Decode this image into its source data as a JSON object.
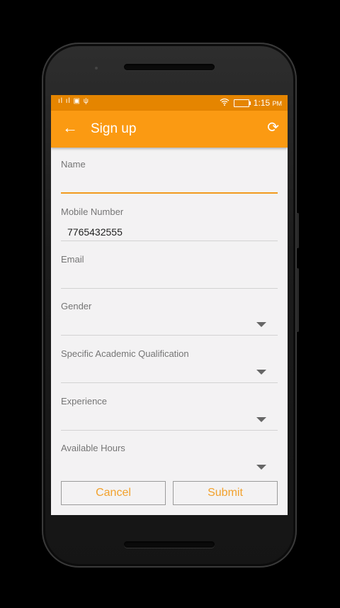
{
  "status_bar": {
    "left_icons": "ıl ıl ▣ ψ",
    "wifi_icon": "wifi-icon",
    "time": "1:15",
    "ampm": "PM"
  },
  "toolbar": {
    "back_icon": "←",
    "title": "Sign up",
    "refresh_icon": "⟳",
    "color": "#fb9a12"
  },
  "form": {
    "name_label": "Name",
    "name_value": "",
    "mobile_label": "Mobile Number",
    "mobile_value": "7765432555",
    "email_label": "Email",
    "email_value": "",
    "gender_label": "Gender",
    "qualification_label": "Specific Academic Qualification",
    "experience_label": "Experience",
    "hours_label": "Available Hours"
  },
  "buttons": {
    "cancel": "Cancel",
    "submit": "Submit"
  },
  "colors": {
    "accent": "#fb9a12",
    "status": "#e58500",
    "button_text": "#f2a12c"
  }
}
